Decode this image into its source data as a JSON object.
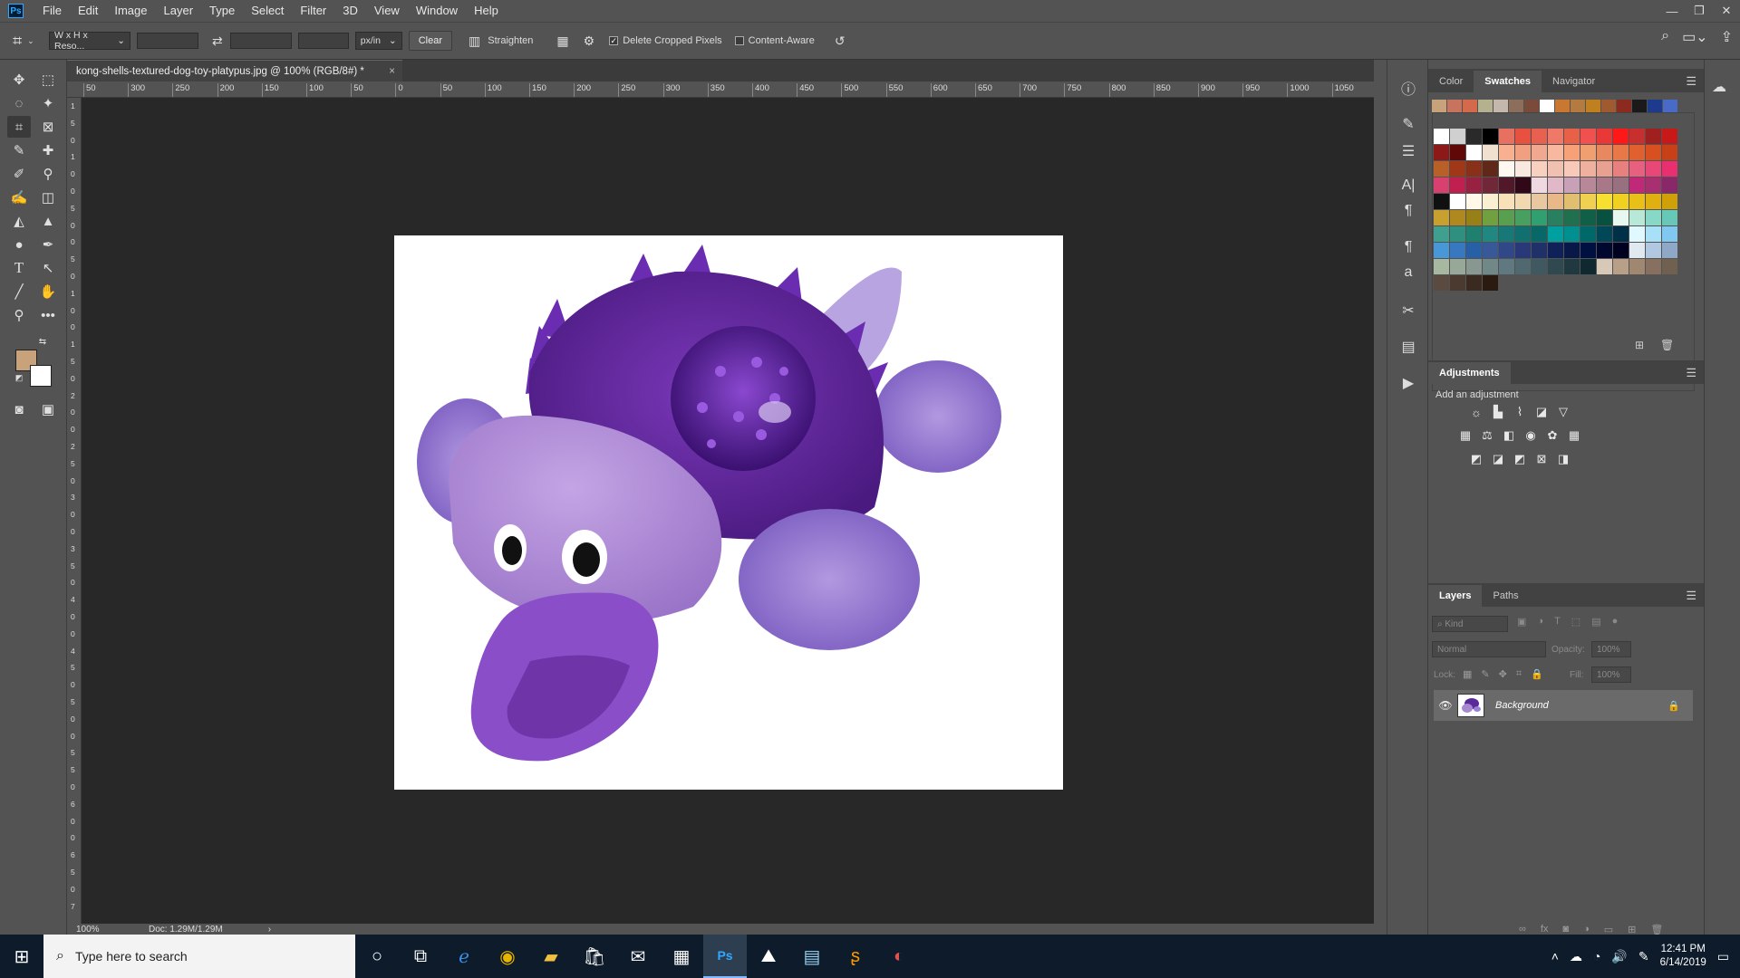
{
  "menu": [
    "File",
    "Edit",
    "Image",
    "Layer",
    "Type",
    "Select",
    "Filter",
    "3D",
    "View",
    "Window",
    "Help"
  ],
  "app_logo": "Ps",
  "window_controls": [
    "—",
    "❐",
    "✕"
  ],
  "options_bar": {
    "ratio_select": "W x H x Reso...",
    "unit_select": "px/in",
    "clear_label": "Clear",
    "straighten_label": "Straighten",
    "delete_cropped_label": "Delete Cropped Pixels",
    "delete_cropped_checked": true,
    "content_aware_label": "Content-Aware",
    "content_aware_checked": false
  },
  "document": {
    "tab_title": "kong-shells-textured-dog-toy-platypus.jpg @ 100% (RGB/8#) *",
    "zoom": "100%",
    "doc_size": "Doc: 1.29M/1.29M"
  },
  "ruler_top_labels": [
    "50",
    "300",
    "250",
    "200",
    "150",
    "100",
    "50",
    "0",
    "50",
    "100",
    "150",
    "200",
    "250",
    "300",
    "350",
    "400",
    "450",
    "500",
    "550",
    "600",
    "650",
    "700",
    "750",
    "800",
    "850",
    "900",
    "950",
    "1000",
    "1050"
  ],
  "ruler_left_labels": [
    "1",
    "5",
    "0",
    "1",
    "0",
    "0",
    "5",
    "0",
    "0",
    "5",
    "0",
    "1",
    "0",
    "0",
    "1",
    "5",
    "0",
    "2",
    "0",
    "0",
    "2",
    "5",
    "0",
    "3",
    "0",
    "0",
    "3",
    "5",
    "0",
    "4",
    "0",
    "0",
    "4",
    "5",
    "0",
    "5",
    "0",
    "0",
    "5",
    "5",
    "0",
    "6",
    "0",
    "0",
    "6",
    "5",
    "0",
    "7"
  ],
  "colors": {
    "foreground": "#c8a27a",
    "background": "#ffffff"
  },
  "panels": {
    "color_tabs": [
      "Color",
      "Swatches",
      "Navigator"
    ],
    "active_color_tab": "Swatches",
    "recent_swatches": [
      "#c8a27a",
      "#c8735e",
      "#d4694b",
      "#b5b18f",
      "#c4b8ad",
      "#8c6e5a",
      "#7a4a3a",
      "#ffffff",
      "#c87830",
      "#b57a40",
      "#c08020",
      "#a05a30",
      "#8c2a20",
      "#1a1a1a",
      "#1e3a8c",
      "#4a6ac8"
    ],
    "swatches": [
      "#ffffff",
      "#d0d0d0",
      "#2a2a2a",
      "#000000",
      "#e87060",
      "#e85040",
      "#e86050",
      "#f07868",
      "#e86048",
      "#f05050",
      "#e83838",
      "#ff1818",
      "#c83030",
      "#a02020",
      "#c81818",
      "#8c1818",
      "#600808",
      "#ffffff",
      "#f0e0d0",
      "#f8b090",
      "#f0a080",
      "#f0a890",
      "#f8b8a0",
      "#f8a078",
      "#f0a070",
      "#e88860",
      "#e87848",
      "#e06030",
      "#d85020",
      "#c84018",
      "#b86028",
      "#a03818",
      "#883018",
      "#602818",
      "#fff8f0",
      "#f8e8e0",
      "#f8d0c0",
      "#f0c0b0",
      "#f8c8b8",
      "#f0b0a0",
      "#e8a090",
      "#e88080",
      "#e86080",
      "#e84878",
      "#e83070",
      "#d84070",
      "#c02050",
      "#982040",
      "#702838",
      "#501828",
      "#300818",
      "#f0d8e0",
      "#e0b8c8",
      "#c8a0b8",
      "#b88898",
      "#a87888",
      "#987080",
      "#c02878",
      "#a83070",
      "#882868",
      "#101010",
      "#ffffff",
      "#fff8e8",
      "#f8f0d0",
      "#f8e0b8",
      "#f0d8b0",
      "#e8c8a0",
      "#e8b888",
      "#e0c070",
      "#f0d050",
      "#f8e030",
      "#f0d020",
      "#e8c018",
      "#e0b010",
      "#d0a008",
      "#c8a030",
      "#b08820",
      "#988018",
      "#70a040",
      "#58a050",
      "#48a060",
      "#30a070",
      "#288060",
      "#207050",
      "#106048",
      "#085040",
      "#e8f8f0",
      "#b8e8d8",
      "#88d8c8",
      "#68c8b8",
      "#40a090",
      "#309080",
      "#208070",
      "#208880",
      "#187878",
      "#107070",
      "#086868",
      "#00a0a0",
      "#009090",
      "#006868",
      "#004858",
      "#003048",
      "#e0f8ff",
      "#a8e0f8",
      "#80c8f0",
      "#4898d8",
      "#3878c0",
      "#2860a8",
      "#385898",
      "#304888",
      "#283878",
      "#203068",
      "#102058",
      "#081848",
      "#001040",
      "#000830",
      "#000020",
      "#e0e8f0",
      "#b0c8e0",
      "#90a8c8",
      "#a8b8a0",
      "#98a898",
      "#889890",
      "#708888",
      "#607880",
      "#506870",
      "#405860",
      "#304850",
      "#203840",
      "#102830",
      "#d8c8b8",
      "#b8a088",
      "#a08870",
      "#887060",
      "#706050",
      "#5a4a40",
      "#4a3a30",
      "#3a2a20",
      "#2a1a10"
    ],
    "adjustments_title": "Adjustments",
    "add_adjustment_label": "Add an adjustment",
    "layers_tabs": [
      "Layers",
      "Paths"
    ],
    "layers_filter_placeholder": "Kind",
    "blend_mode": "Normal",
    "opacity_label": "Opacity:",
    "opacity_value": "100%",
    "lock_label": "Lock:",
    "fill_label": "Fill:",
    "fill_value": "100%",
    "layers": [
      {
        "name": "Background",
        "visible": true,
        "locked": true
      }
    ]
  },
  "taskbar": {
    "search_placeholder": "Type here to search",
    "time": "12:41 PM",
    "date": "6/14/2019"
  }
}
